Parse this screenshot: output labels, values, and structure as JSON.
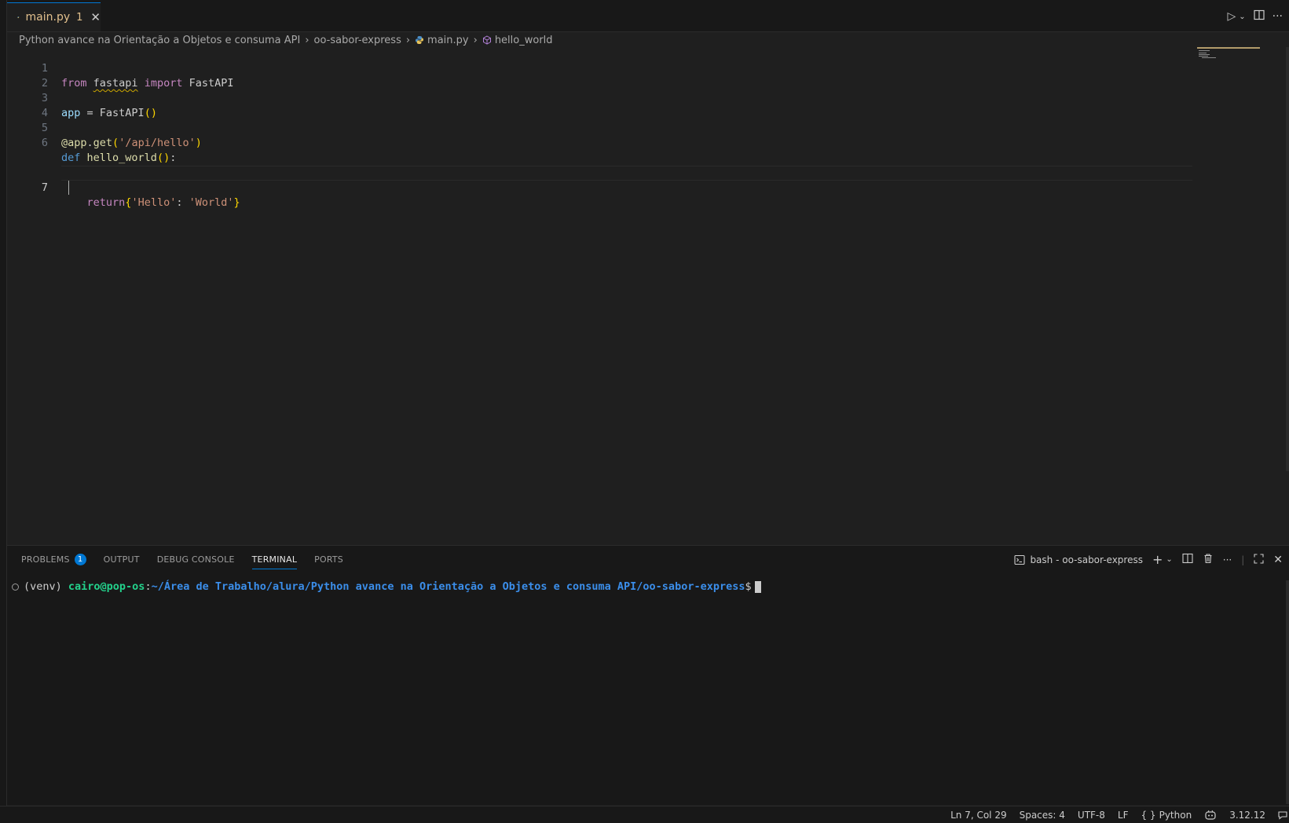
{
  "tab": {
    "filename": "main.py",
    "problem_count": "1"
  },
  "breadcrumb": {
    "items": [
      "Python avance na Orientação a Objetos e consuma API",
      "oo-sabor-express",
      "main.py",
      "hello_world"
    ]
  },
  "editor": {
    "line_numbers": [
      "1",
      "2",
      "3",
      "4",
      "5",
      "6",
      "7"
    ],
    "current_line": "7",
    "tokens": {
      "l1_from": "from",
      "l1_mod": "fastapi",
      "l1_import": "import",
      "l1_name": "FastAPI",
      "l3_var": "app",
      "l3_eq": " = ",
      "l3_fn": "FastAPI",
      "l3_parens": "()",
      "l5_dec": "@app",
      "l5_dot": ".",
      "l5_get": "get",
      "l5_open": "(",
      "l5_str": "'/api/hello'",
      "l5_close": ")",
      "l6_def": "def",
      "l6_fn": "hello_world",
      "l6_parens": "()",
      "l6_colon": ":",
      "l7_return": "return",
      "l7_open": "{",
      "l7_k": "'Hello'",
      "l7_colon": ": ",
      "l7_v": "'World'",
      "l7_close": "}"
    }
  },
  "panel": {
    "tabs": [
      "PROBLEMS",
      "OUTPUT",
      "DEBUG CONSOLE",
      "TERMINAL",
      "PORTS"
    ],
    "problems_badge": "1",
    "active_tab": "TERMINAL",
    "terminal_name": "bash - oo-sabor-express",
    "terminal": {
      "venv": "(venv) ",
      "user_host": "cairo@pop-os",
      "colon": ":",
      "path": "~/Área de Trabalho/alura/Python avance na Orientação a Objetos e consuma API/oo-sabor-express",
      "prompt": "$"
    }
  },
  "statusbar": {
    "position": "Ln 7, Col 29",
    "spaces": "Spaces: 4",
    "encoding": "UTF-8",
    "eol": "LF",
    "language_braces": "{ }",
    "language": "Python",
    "python_version": "3.12.12"
  },
  "colors": {
    "accent": "#0078d4",
    "modified_tab": "#e2c08d",
    "terminal_user": "#23d18b",
    "terminal_path": "#3b8eea"
  }
}
